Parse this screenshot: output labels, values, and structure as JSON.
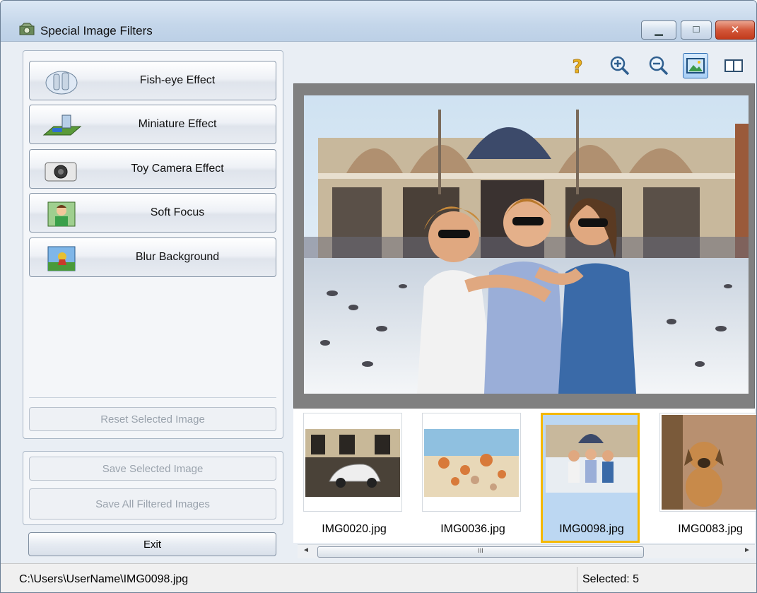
{
  "window": {
    "title": "Special Image Filters"
  },
  "effects": [
    {
      "label": "Fish-eye Effect",
      "icon": "fish-eye-icon"
    },
    {
      "label": "Miniature Effect",
      "icon": "miniature-icon"
    },
    {
      "label": "Toy Camera Effect",
      "icon": "toy-camera-icon"
    },
    {
      "label": "Soft Focus",
      "icon": "soft-focus-icon"
    },
    {
      "label": "Blur Background",
      "icon": "blur-background-icon"
    }
  ],
  "actions": {
    "reset_label": "Reset Selected Image",
    "save_selected_label": "Save Selected Image",
    "save_all_label": "Save All Filtered Images",
    "exit_label": "Exit"
  },
  "toolbar": {
    "icons": [
      "help-icon",
      "zoom-in-icon",
      "zoom-out-icon",
      "whole-image-view-icon",
      "compare-view-icon"
    ]
  },
  "thumbnails": [
    {
      "name": "IMG0020.jpg",
      "selected": false
    },
    {
      "name": "IMG0036.jpg",
      "selected": false
    },
    {
      "name": "IMG0098.jpg",
      "selected": true
    },
    {
      "name": "IMG0083.jpg",
      "selected": false
    }
  ],
  "scrollbar": {
    "grip": "III"
  },
  "status": {
    "path": "C:\\Users\\UserName\\IMG0098.jpg",
    "selected": "Selected: 5"
  },
  "colors": {
    "selection": "#f5b800",
    "titlebar": "#c4d6ea",
    "close": "#d3573a"
  }
}
